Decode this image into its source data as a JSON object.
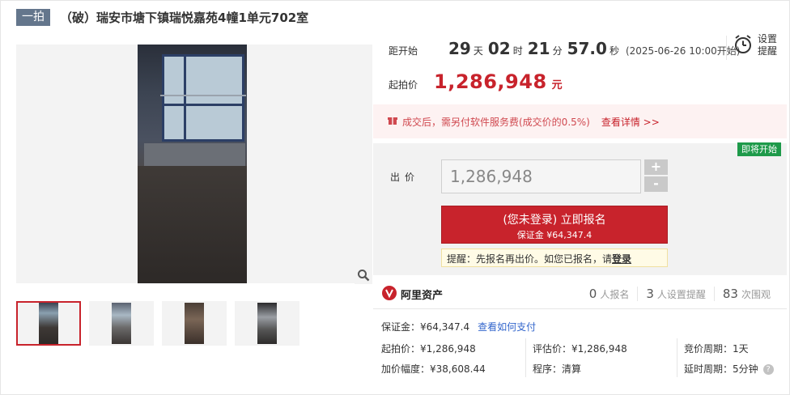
{
  "header": {
    "round_badge": "一拍",
    "title": "（破）瑞安市塘下镇瑞悦嘉苑4幢1单元702室"
  },
  "countdown": {
    "label": "距开始",
    "days": "29",
    "days_unit": "天",
    "hours": "02",
    "hours_unit": "时",
    "minutes": "21",
    "minutes_unit": "分",
    "seconds": "57.0",
    "seconds_unit": "秒",
    "start_time": "(2025-06-26 10:00开始)"
  },
  "remind": {
    "label_line1": "设置",
    "label_line2": "提醒"
  },
  "starting_price": {
    "label": "起拍价",
    "value": "1,286,948",
    "unit": "元"
  },
  "notice": {
    "text": "成交后，需另付软件服务费(成交价的0.5%)",
    "link": "查看详情 >>"
  },
  "bid": {
    "status_tag": "即将开始",
    "label": "出价",
    "input_value": "1,286,948",
    "plus": "+",
    "minus": "-",
    "signup_main": "(您未登录) 立即报名",
    "signup_sub": "保证金 ¥64,347.4",
    "tip_text": "提醒：先报名再出价。如您已报名，请",
    "tip_link": "登录"
  },
  "brand": {
    "name": "阿里资产"
  },
  "stats": [
    {
      "num": "0",
      "label": "人报名"
    },
    {
      "num": "3",
      "label": "人设置提醒"
    },
    {
      "num": "83",
      "label": "次围观"
    }
  ],
  "details": {
    "deposit": "保证金：¥64,347.4",
    "deposit_link": "查看如何支付",
    "start_price": "起拍价：¥1,286,948",
    "eval_price": "评估价：¥1,286,948",
    "cycle": "竞价周期：1天",
    "increment": "加价幅度：¥38,608.44",
    "procedure": "程序：清算",
    "delay": "延时周期：5分钟",
    "help": "?"
  },
  "colors": {
    "accent": "#c8232c",
    "status_green": "#1e9a4a",
    "badge": "#64768c",
    "link": "#3366cc"
  }
}
